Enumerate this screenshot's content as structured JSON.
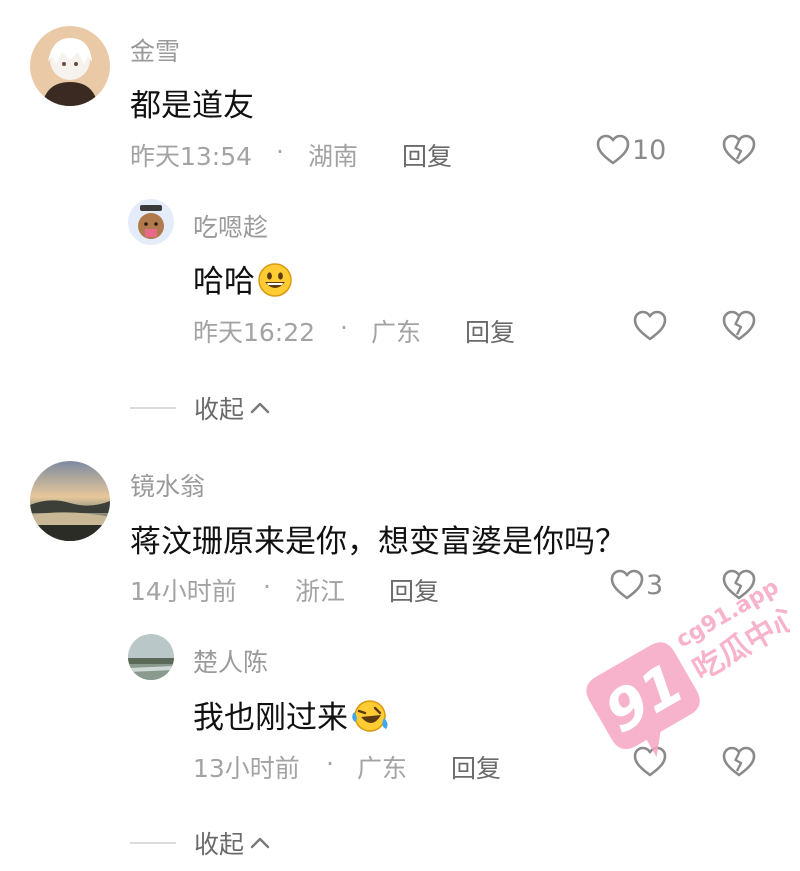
{
  "comments": [
    {
      "username": "金雪",
      "text": "都是道友",
      "time": "昨天13:54",
      "sep": "·",
      "location": "湖南",
      "reply_label": "回复",
      "likes": "10",
      "replies": [
        {
          "username": "吃嗯趁",
          "text": "哈哈",
          "emoji_icon": "smiley-emoji-icon",
          "time": "昨天16:22",
          "sep": "·",
          "location": "广东",
          "reply_label": "回复",
          "likes": ""
        }
      ],
      "collapse_label": "收起"
    },
    {
      "username": "镜水翁",
      "text": "蒋汶珊原来是你，想变富婆是你吗？",
      "time": "14小时前",
      "sep": "·",
      "location": "浙江",
      "reply_label": "回复",
      "likes": "3",
      "replies": [
        {
          "username": "楚人陈",
          "text": "我也刚过来",
          "emoji_icon": "laughing-tears-emoji-icon",
          "time": "13小时前",
          "sep": "·",
          "location": "广东",
          "reply_label": "回复",
          "likes": ""
        }
      ],
      "collapse_label": "收起"
    }
  ],
  "watermark": {
    "number": "91",
    "domain": "cg91.app",
    "slogan": "吃瓜中心",
    "color": "#f7a6c4"
  },
  "colors": {
    "text_primary": "#111111",
    "text_secondary": "#a3a3a3",
    "icon": "#8a8a8a"
  }
}
